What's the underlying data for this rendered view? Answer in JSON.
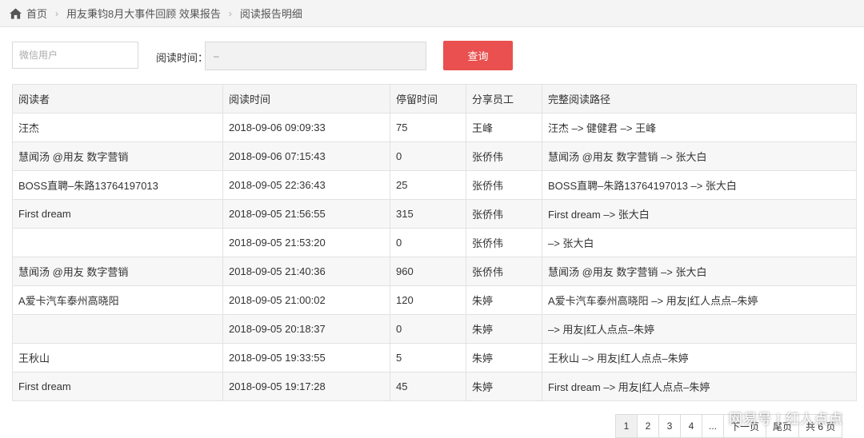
{
  "breadcrumb": {
    "home": "首页",
    "items": [
      "用友秉钧8月大事件回顾 效果报告",
      "阅读报告明细"
    ]
  },
  "filter": {
    "user_placeholder": "微信用户",
    "time_label": "阅读时间：",
    "time_value": "–",
    "query_label": "查询"
  },
  "table": {
    "headers": [
      "阅读者",
      "阅读时间",
      "停留时间",
      "分享员工",
      "完整阅读路径"
    ],
    "rows": [
      [
        "汪杰",
        "2018-09-06 09:09:33",
        "75",
        "王峰",
        "汪杰 –> 健健君 –> 王峰"
      ],
      [
        "慧闻汤 @用友 数字营销",
        "2018-09-06 07:15:43",
        "0",
        "张侨伟",
        "慧闻汤 @用友 数字营销 –> 张大白"
      ],
      [
        "BOSS直聘–朱路13764197013",
        "2018-09-05 22:36:43",
        "25",
        "张侨伟",
        "BOSS直聘–朱路13764197013 –> 张大白"
      ],
      [
        "First dream",
        "2018-09-05 21:56:55",
        "315",
        "张侨伟",
        "First dream –> 张大白"
      ],
      [
        "",
        "2018-09-05 21:53:20",
        "0",
        "张侨伟",
        "–> 张大白"
      ],
      [
        "慧闻汤 @用友 数字营销",
        "2018-09-05 21:40:36",
        "960",
        "张侨伟",
        "慧闻汤 @用友 数字营销 –> 张大白"
      ],
      [
        "A爱卡汽车泰州高晓阳",
        "2018-09-05 21:00:02",
        "120",
        "朱婷",
        "A爱卡汽车泰州高晓阳 –> 用友|红人点点–朱婷"
      ],
      [
        "",
        "2018-09-05 20:18:37",
        "0",
        "朱婷",
        "–> 用友|红人点点–朱婷"
      ],
      [
        "王秋山",
        "2018-09-05 19:33:55",
        "5",
        "朱婷",
        "王秋山 –> 用友|红人点点–朱婷"
      ],
      [
        "First dream",
        "2018-09-05 19:17:28",
        "45",
        "朱婷",
        "First dream –> 用友|红人点点–朱婷"
      ]
    ]
  },
  "pagination": {
    "pages": [
      "1",
      "2",
      "3",
      "4",
      "...",
      "下一页",
      "尾页",
      "共 6 页"
    ],
    "current": "1"
  },
  "watermark": "网易号 | 红人点点"
}
